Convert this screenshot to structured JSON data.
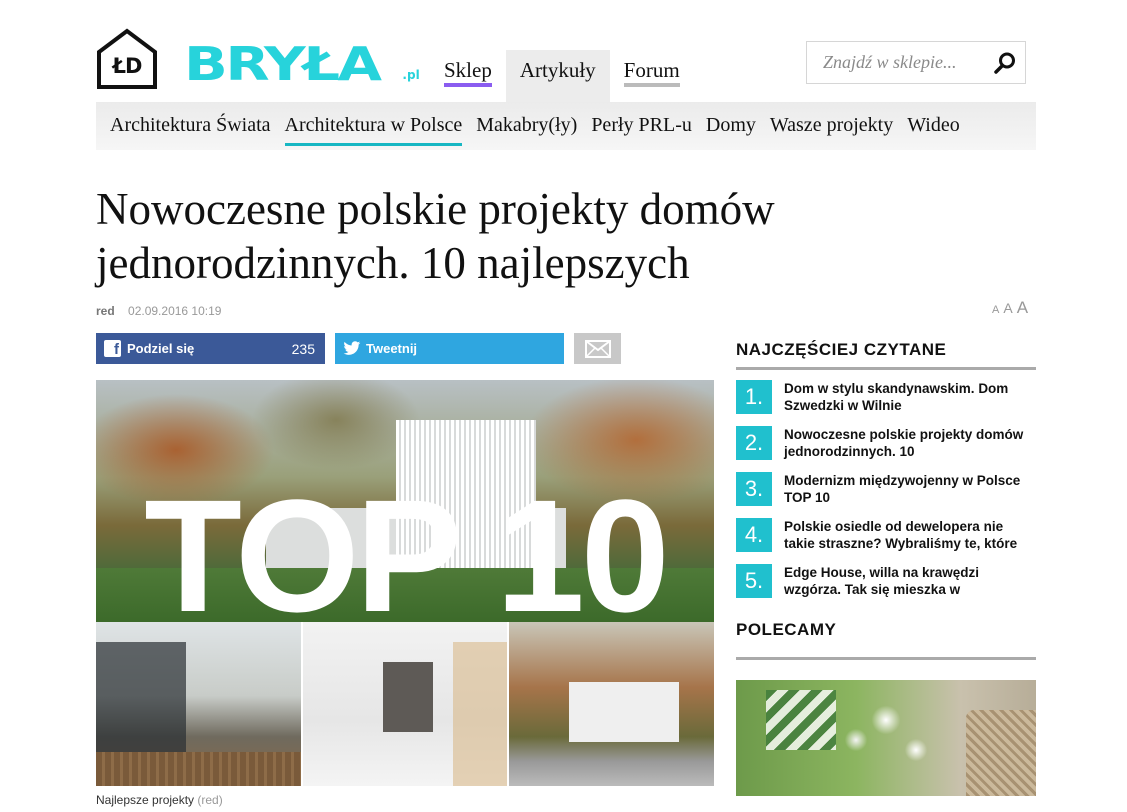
{
  "header": {
    "logo_house_text": "ŁD",
    "logo_word": "BRYŁA",
    "logo_suffix": ".pl",
    "main_nav": [
      {
        "label": "Sklep",
        "active": false
      },
      {
        "label": "Artykuły",
        "active": true
      },
      {
        "label": "Forum",
        "active": false
      }
    ],
    "search_placeholder": "Znajdź w sklepie..."
  },
  "sub_nav": [
    {
      "label": "Architektura Świata",
      "active": false
    },
    {
      "label": "Architektura w Polsce",
      "active": true
    },
    {
      "label": "Makabry(ły)",
      "active": false
    },
    {
      "label": "Perły PRL-u",
      "active": false
    },
    {
      "label": "Domy",
      "active": false
    },
    {
      "label": "Wasze projekty",
      "active": false
    },
    {
      "label": "Wideo",
      "active": false
    }
  ],
  "article": {
    "title": "Nowoczesne polskie projekty domów jednorodzinnych. 10 najlepszych",
    "author": "red",
    "date": "02.09.2016 10:19",
    "font_size_labels": [
      "A",
      "A",
      "A"
    ],
    "share": {
      "fb_label": "Podziel się",
      "fb_count": "235",
      "fb_icon_letter": "f",
      "tw_label": "Tweetnij"
    },
    "hero_text": "TOP 10",
    "caption": "Najlepsze projekty",
    "caption_source": "(red)"
  },
  "sidebar": {
    "popular_heading": "NAJCZĘŚCIEJ CZYTANE",
    "popular": [
      {
        "num": "1.",
        "text": "Dom w stylu skandynawskim. Dom Szwedzki w Wilnie"
      },
      {
        "num": "2.",
        "text": "Nowoczesne polskie projekty domów jednorodzinnych. 10"
      },
      {
        "num": "3.",
        "text": "Modernizm międzywojenny w Polsce TOP 10"
      },
      {
        "num": "4.",
        "text": "Polskie osiedle od dewelopera nie takie straszne? Wybraliśmy te, które"
      },
      {
        "num": "5.",
        "text": "Edge House, willa na krawędzi wzgórza. Tak się mieszka w"
      }
    ],
    "recommended_heading": "POLECAMY"
  },
  "colors": {
    "brand_cyan": "#27d3db",
    "accent_teal": "#17b7c3",
    "sklep_purple": "#8a5cf0",
    "facebook": "#3b5998",
    "twitter": "#2fa6e0",
    "number_badge": "#20c0ce"
  }
}
